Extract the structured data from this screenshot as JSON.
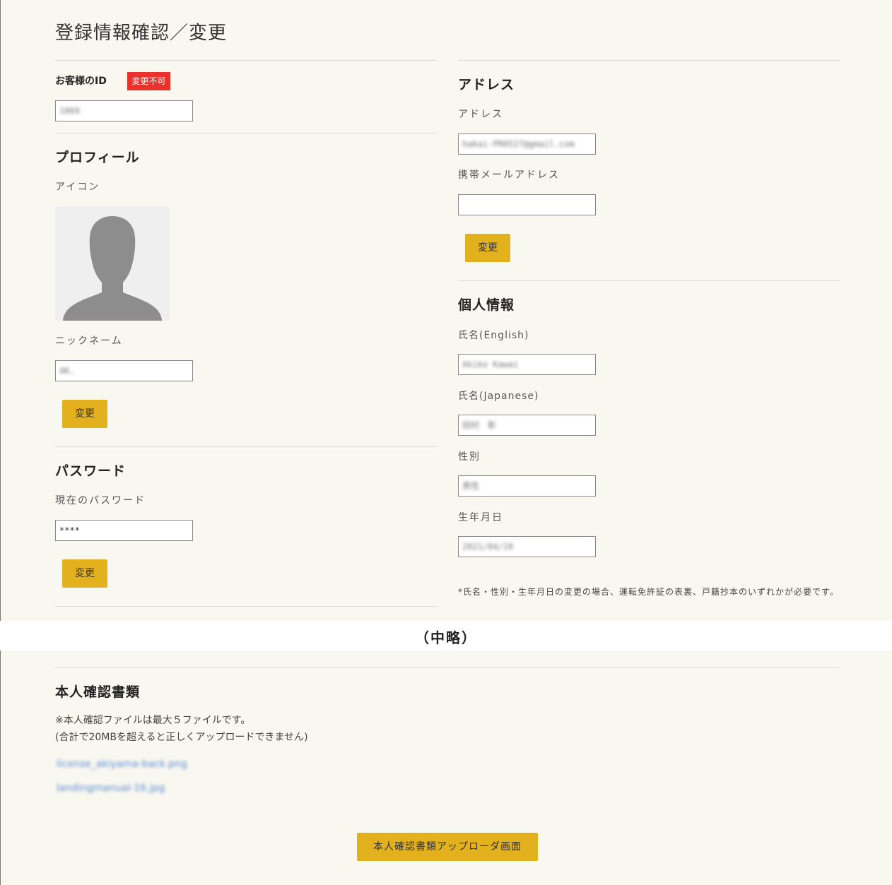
{
  "page": {
    "title": "登録情報確認／変更"
  },
  "customer_id": {
    "label": "お客様のID",
    "badge": "変更不可",
    "value": "1869"
  },
  "profile": {
    "heading": "プロフィール",
    "icon_label": "アイコン",
    "avatar_icon": "person-silhouette-icon",
    "nickname_label": "ニックネーム",
    "nickname_value": "AK.",
    "change_label": "変更"
  },
  "password": {
    "heading": "パスワード",
    "current_label": "現在のパスワード",
    "current_value": "****",
    "change_label": "変更"
  },
  "address": {
    "heading": "アドレス",
    "address_label": "アドレス",
    "address_value": "hakai-PR0527@gmail.com",
    "mobile_label": "携帯メールアドレス",
    "mobile_value": "",
    "change_label": "変更"
  },
  "personal": {
    "heading": "個人情報",
    "name_en_label": "氏名(English)",
    "name_en_value": "Akiko Kawai",
    "name_ja_label": "氏名(Japanese)",
    "name_ja_value": "田村　彰",
    "gender_label": "性別",
    "gender_value": "男性",
    "birthday_label": "生年月日",
    "birthday_value": "2021/04/10",
    "note": "*氏名・性別・生年月日の変更の場合、運転免許証の表裏、戸籍抄本のいずれかが必要です。"
  },
  "omitted_label": "（中略）",
  "id_docs": {
    "heading": "本人確認書類",
    "note_line1": "※本人確認ファイルは最大５ファイルです。",
    "note_line2": "(合計で20MBを超えると正しくアップロードできません)",
    "files": [
      "license_akiyama-back.png",
      "landingmanual-16.jpg"
    ],
    "upload_button": "本人確認書類アップローダ画面"
  },
  "colors": {
    "accent": "#e3b01e",
    "badge": "#e8322b",
    "background": "#f9f8f0"
  }
}
